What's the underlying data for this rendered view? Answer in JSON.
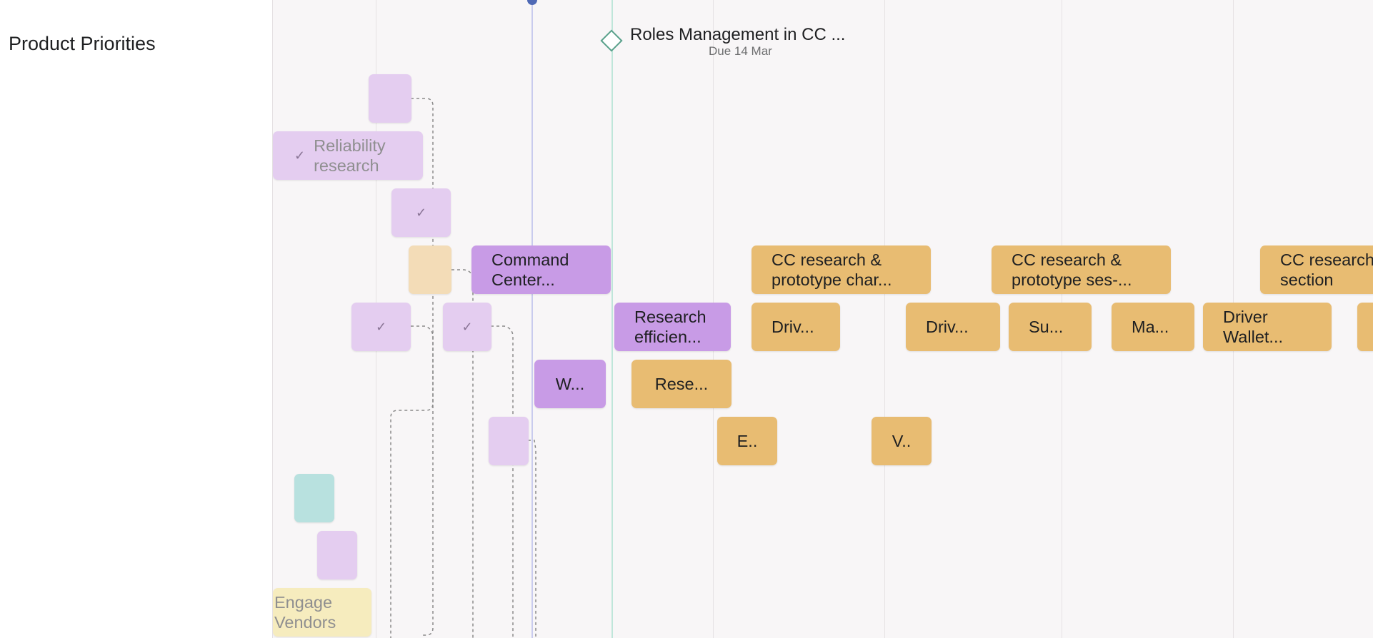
{
  "project": {
    "section_title": "Product Priorities"
  },
  "milestone": {
    "title": "Roles Management in CC ...",
    "due": "Due 14 Mar",
    "icon": "diamond-milestone-icon"
  },
  "today_marker": {
    "color": "#4f69b5"
  },
  "colors": {
    "purple": "#c89be6",
    "orange": "#e8bc72",
    "lavender_faded": "#e4cdf0",
    "teal_faded": "#b8e1df",
    "yellow_faded": "#f6ecbe",
    "milestone": "#58a08a"
  },
  "tasks": {
    "reliability": "Reliability\nresearch",
    "command_center": "Command\nCenter...",
    "research_efficiency": "Research\nefficien...",
    "w": "W...",
    "rese": "Rese...",
    "cc1": "CC research &\nprototype char...",
    "cc2": "CC research &\nprototype ses-...",
    "cc3": "CC research\nsection",
    "driv1": "Driv...",
    "driv2": "Driv...",
    "su": "Su...",
    "ma": "Ma...",
    "driver_wallet": "Driver\nWallet...",
    "e": "E..",
    "v": "V..",
    "engage_vendors": "Engage\nVendors"
  }
}
